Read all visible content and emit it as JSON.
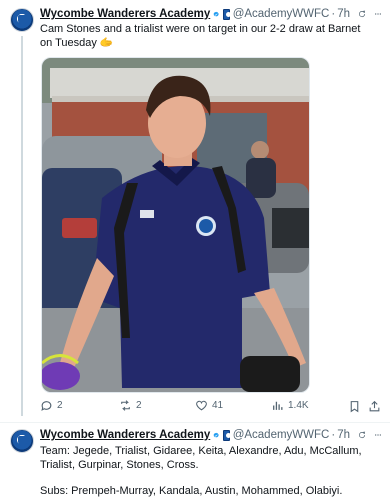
{
  "tweet1": {
    "name": "Wycombe Wanderers Academy",
    "handle": "@AcademyWWFC",
    "time": "7h",
    "text": "Cam Stones and a trialist were on target in our 2-2 draw at Barnet on Tuesday 🫱",
    "metrics": {
      "replies": "2",
      "reposts": "2",
      "likes": "41",
      "views": "1.4K"
    }
  },
  "tweet2": {
    "name": "Wycombe Wanderers Academy",
    "handle": "@AcademyWWFC",
    "time": "7h",
    "team": "Team: Jegede, Trialist, Gidaree, Keita, Alexandre, Adu, McCallum, Trialist, Gurpinar, Stones, Cross.",
    "subs": "Subs: Prempeh-Murray, Kandala, Austin, Mohammed, Olabiyi."
  },
  "dot": "·",
  "icons": [
    "verified-icon",
    "club-badge-icon",
    "grok-icon",
    "more-icon",
    "reply-icon",
    "repost-icon",
    "like-icon",
    "views-icon",
    "bookmark-icon",
    "share-icon"
  ],
  "colors": {
    "accent": "#1d9bf0",
    "muted": "#536471",
    "text": "#0f1419",
    "kit": "#1e2a6e"
  }
}
